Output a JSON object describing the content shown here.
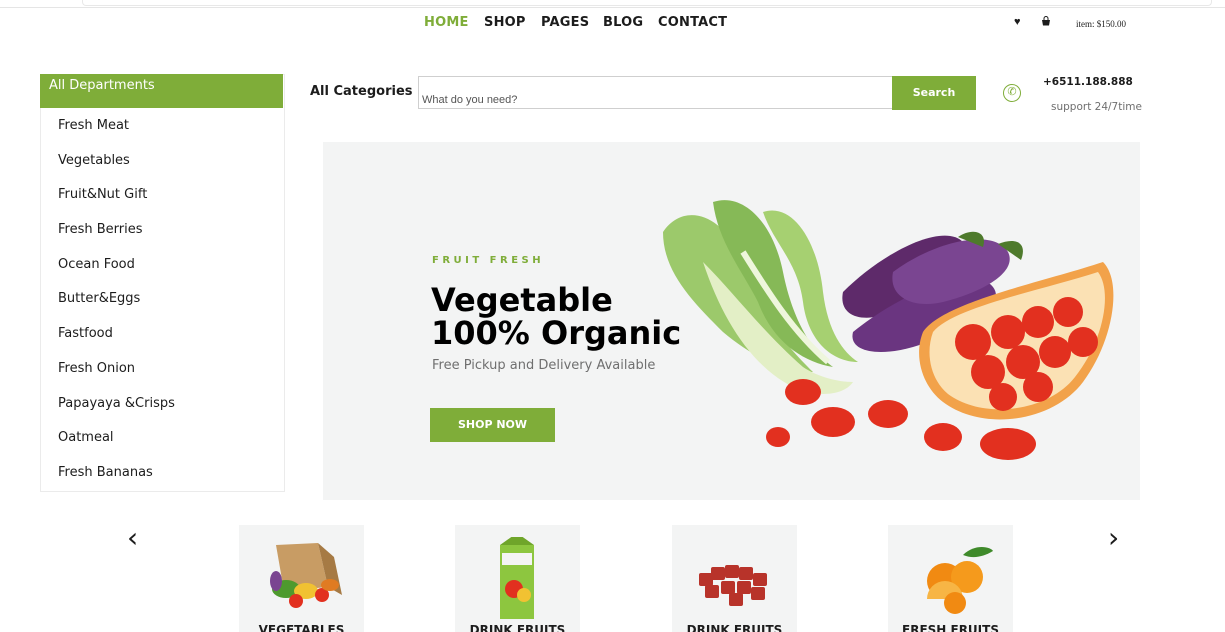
{
  "nav": {
    "home": "HOME",
    "shop": "SHOP",
    "pages": "PAGES",
    "blog": "BLOG",
    "contact": "CONTACT",
    "accent_color": "#7fad39"
  },
  "header": {
    "wishlist_icon": "heart-icon",
    "cart_icon": "bag-icon",
    "cart_total": "item: $150.00"
  },
  "departments": {
    "title": "All Departments",
    "items": [
      "Fresh Meat",
      "Vegetables",
      "Fruit&Nut Gift",
      "Fresh Berries",
      "Ocean Food",
      "Butter&Eggs",
      "Fastfood",
      "Fresh Onion",
      "Papayaya &Crisps",
      "Oatmeal",
      "Fresh Bananas"
    ]
  },
  "search": {
    "category_label": "All Categories",
    "placeholder": "What do you need?",
    "button_label": "Search"
  },
  "contact": {
    "phone": "+6511.188.888",
    "support": "support 24/7time",
    "icon": "phone-icon"
  },
  "hero": {
    "eyebrow": "FRUIT FRESH",
    "title_line1": "Vegetable",
    "title_line2": "100% Organic",
    "subtitle": "Free Pickup and Delivery Available",
    "button_label": "SHOP NOW"
  },
  "categories": [
    {
      "label": "VEGETABLES",
      "icon": "grocery-bag-icon"
    },
    {
      "label": "DRINK FRUITS",
      "icon": "juice-carton-icon"
    },
    {
      "label": "DRINK FRUITS",
      "icon": "meat-cubes-icon"
    },
    {
      "label": "FRESH FRUITS",
      "icon": "oranges-icon"
    }
  ]
}
